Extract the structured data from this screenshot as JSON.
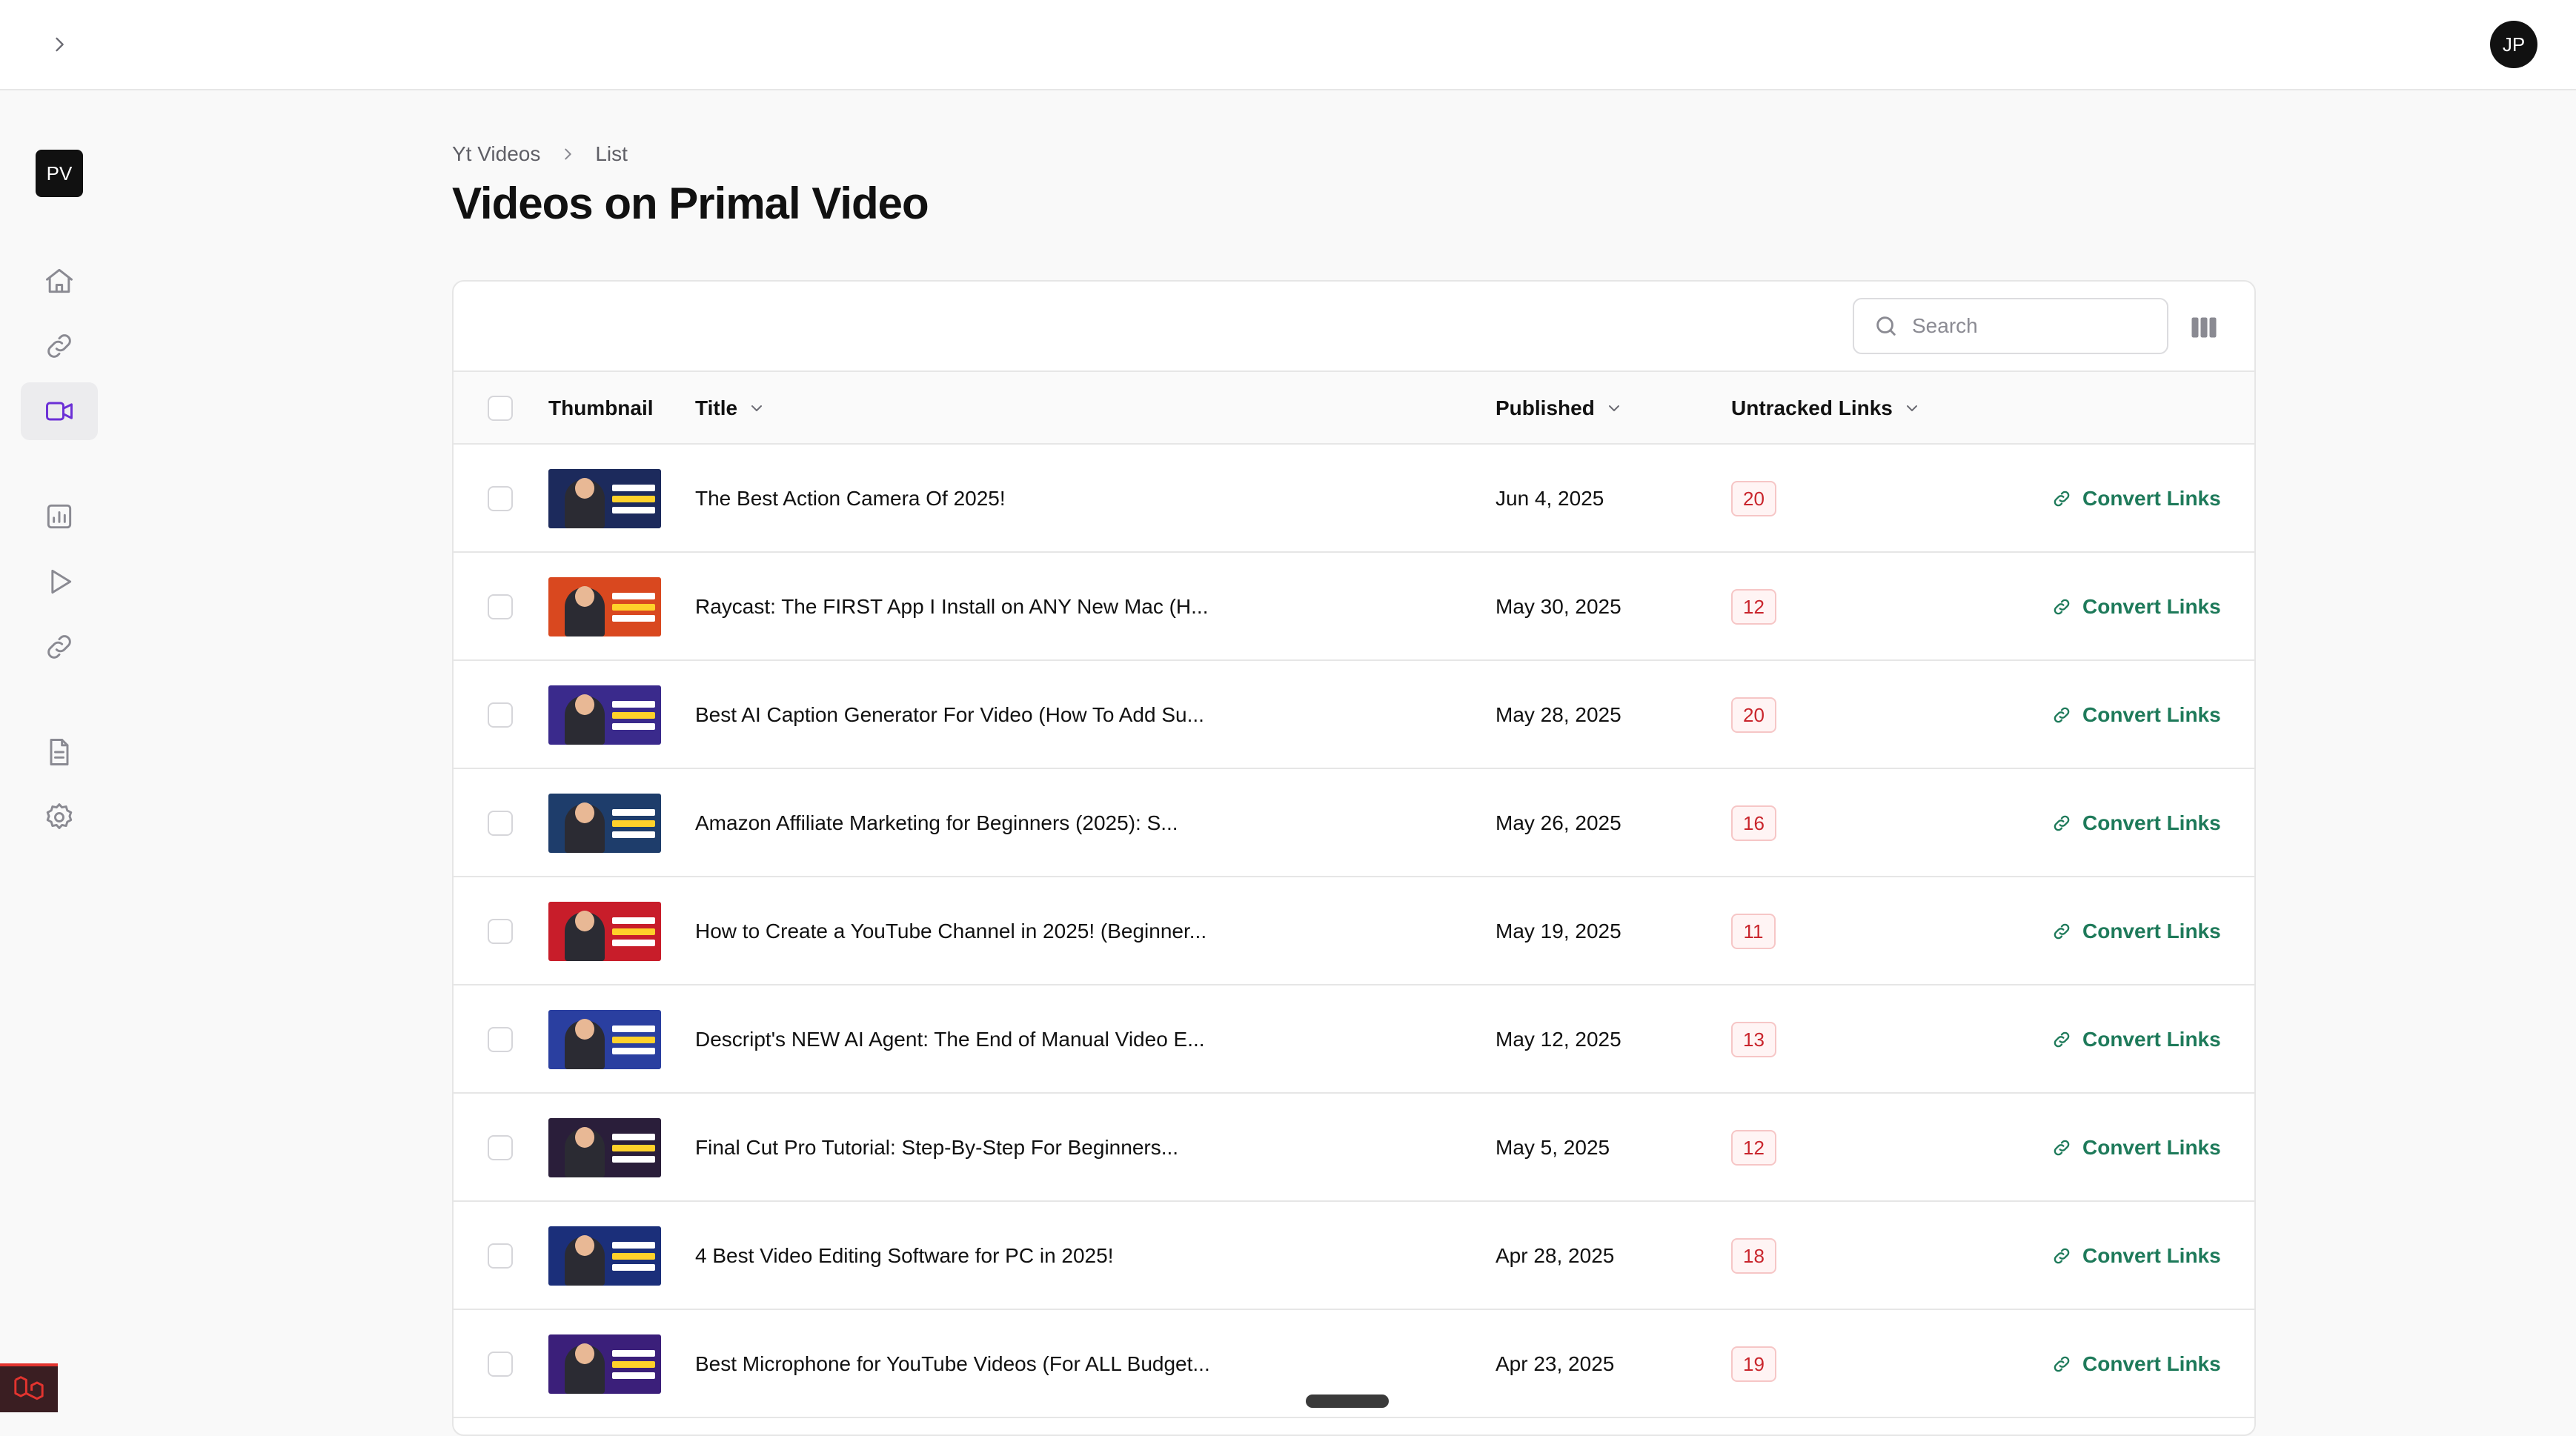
{
  "app": {
    "user_initials": "JP",
    "brand_initials": "PV"
  },
  "sidebar": {
    "items": [
      {
        "icon": "home-icon",
        "active": false
      },
      {
        "icon": "link-icon",
        "active": false
      },
      {
        "icon": "video-camera-icon",
        "active": true
      },
      {
        "icon": "chart-icon",
        "active": false
      },
      {
        "icon": "play-icon",
        "active": false
      },
      {
        "icon": "link-icon",
        "active": false
      },
      {
        "icon": "document-icon",
        "active": false
      },
      {
        "icon": "gear-icon",
        "active": false
      }
    ]
  },
  "breadcrumb": {
    "items": [
      "Yt Videos",
      "List"
    ]
  },
  "page": {
    "title": "Videos on Primal Video"
  },
  "toolbar": {
    "search_placeholder": "Search"
  },
  "table": {
    "headers": {
      "thumbnail": "Thumbnail",
      "title": "Title",
      "published": "Published",
      "untracked_links": "Untracked Links"
    },
    "action_label": "Convert Links",
    "rows": [
      {
        "title": "The Best Action Camera Of 2025!",
        "published": "Jun 4, 2025",
        "untracked": "20",
        "thumb_bg": "#1c2a5c"
      },
      {
        "title": "Raycast: The FIRST App I Install on ANY New Mac (H...",
        "published": "May 30, 2025",
        "untracked": "12",
        "thumb_bg": "#d9481f"
      },
      {
        "title": "Best AI Caption Generator For Video (How To Add Su...",
        "published": "May 28, 2025",
        "untracked": "20",
        "thumb_bg": "#3a2a8c"
      },
      {
        "title": "Amazon Affiliate Marketing for Beginners (2025): S...",
        "published": "May 26, 2025",
        "untracked": "16",
        "thumb_bg": "#1e3d6b"
      },
      {
        "title": "How to Create a YouTube Channel in 2025! (Beginner...",
        "published": "May 19, 2025",
        "untracked": "11",
        "thumb_bg": "#c81d2a"
      },
      {
        "title": "Descript's NEW AI Agent: The End of Manual Video E...",
        "published": "May 12, 2025",
        "untracked": "13",
        "thumb_bg": "#2a3fa0"
      },
      {
        "title": "Final Cut Pro Tutorial: Step-By-Step For Beginners...",
        "published": "May 5, 2025",
        "untracked": "12",
        "thumb_bg": "#2a1e3a"
      },
      {
        "title": "4 Best Video Editing Software for PC in 2025!",
        "published": "Apr 28, 2025",
        "untracked": "18",
        "thumb_bg": "#1b2f7a"
      },
      {
        "title": "Best Microphone for YouTube Videos (For ALL Budget...",
        "published": "Apr 23, 2025",
        "untracked": "19",
        "thumb_bg": "#3b1f7a"
      }
    ]
  },
  "colors": {
    "accent_green": "#1e7a5a",
    "badge_red": "#c9252c",
    "active_nav_icon": "#6b2fd6"
  }
}
